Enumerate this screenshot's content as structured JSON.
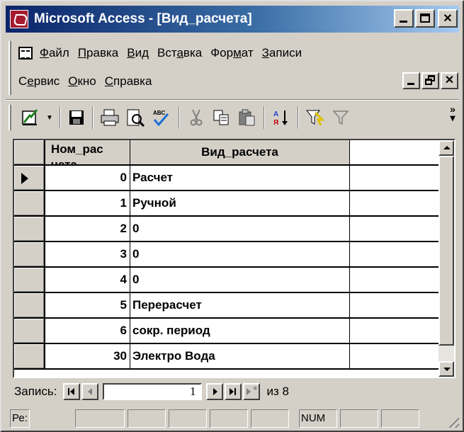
{
  "window": {
    "title": "Microsoft Access - [Вид_расчета]"
  },
  "menu": {
    "row1": [
      {
        "label": "Файл",
        "hotkey_index": 0
      },
      {
        "label": "Правка",
        "hotkey_index": 0
      },
      {
        "label": "Вид",
        "hotkey_index": 0
      },
      {
        "label": "Вставка",
        "hotkey_index": 3
      },
      {
        "label": "Формат",
        "hotkey_index": 3
      },
      {
        "label": "Записи",
        "hotkey_index": 0
      }
    ],
    "row2": [
      {
        "label": "Сервис",
        "hotkey_index": 1
      },
      {
        "label": "Окно",
        "hotkey_index": 0
      },
      {
        "label": "Справка",
        "hotkey_index": 0
      }
    ]
  },
  "toolbar": {
    "icons": [
      "design-view-icon",
      "save-icon",
      "print-icon",
      "print-preview-icon",
      "spelling-icon",
      "cut-icon",
      "copy-icon",
      "paste-icon",
      "sort-ascending-icon",
      "filter-by-selection-icon",
      "filter-by-form-icon"
    ],
    "more": "»"
  },
  "datasheet": {
    "columns": [
      "Ном_рас",
      "Вид_расчета"
    ],
    "header_wrap_fragment": "чета",
    "rows": [
      {
        "num": "0",
        "name": "Расчет",
        "current": true
      },
      {
        "num": "1",
        "name": "Ручной"
      },
      {
        "num": "2",
        "name": "0"
      },
      {
        "num": "3",
        "name": "0"
      },
      {
        "num": "4",
        "name": "0"
      },
      {
        "num": "5",
        "name": "Перерасчет"
      },
      {
        "num": "6",
        "name": "сокр. период"
      },
      {
        "num": "30",
        "name": "Электро Вода"
      }
    ]
  },
  "record_nav": {
    "label": "Запись:",
    "current": "1",
    "of_text": "из 8"
  },
  "statusbar": {
    "mode_text": "Ре:",
    "num_indicator": "NUM"
  },
  "colors": {
    "title_start": "#0a246a",
    "title_end": "#a6caf0",
    "face": "#d4d0c8"
  }
}
